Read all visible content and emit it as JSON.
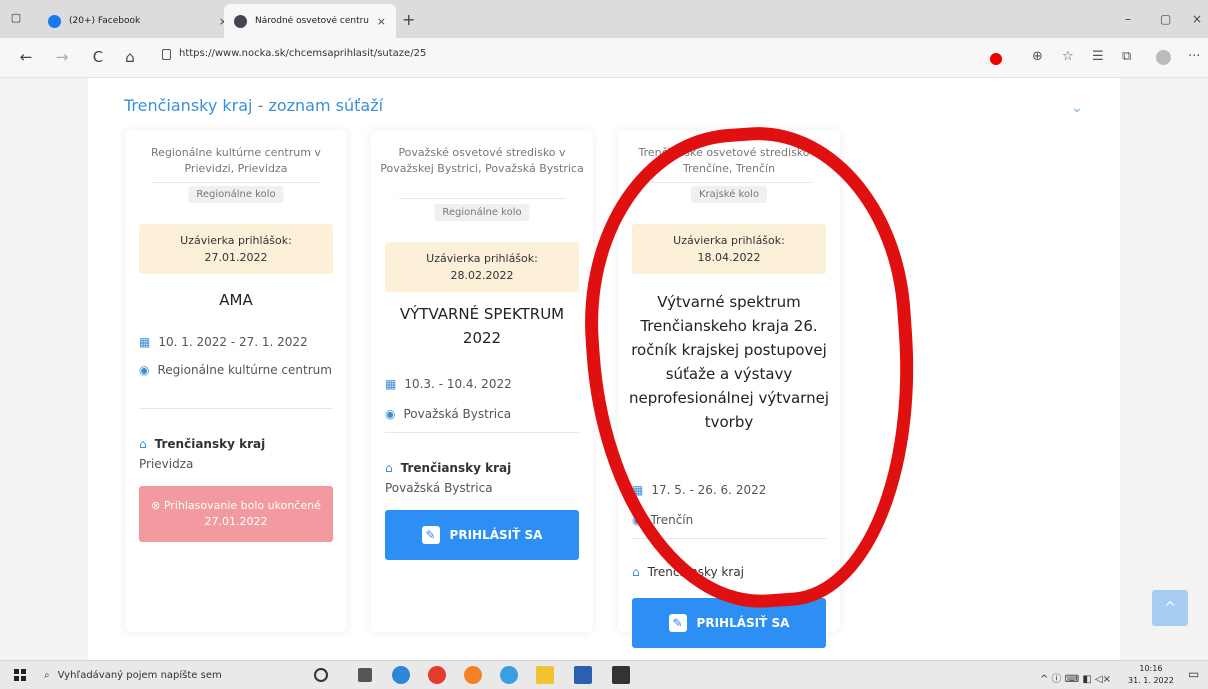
{
  "browser": {
    "tabs": [
      {
        "title": "(20+) Facebook",
        "close": "×"
      },
      {
        "title": "Národné osvetové centrum - pri",
        "close": "×"
      }
    ],
    "new_tab": "+",
    "url": "https://www.nocka.sk/chcemsaprihlasit/sutaze/25",
    "nav": {
      "back": "←",
      "forward": "→",
      "reload": "C",
      "home": "⌂"
    },
    "window_controls": {
      "minimize": "–",
      "maximize": "▢",
      "close": "×"
    },
    "more": "···",
    "accent_color": "#3a8fd8"
  },
  "page": {
    "title": "Trenčiansky kraj - zoznam súťaží",
    "collapse_icon": "⌄",
    "scroll_top_icon": "^"
  },
  "cards": [
    {
      "org": "Regionálne kultúrne centrum v Prievidzi, Prievidza",
      "round": "Regionálne kolo",
      "deadline_label": "Uzávierka prihlášok:",
      "deadline_date": "27.01.2022",
      "title": "AMA",
      "date_range": "10. 1. 2022 - 27. 1. 2022",
      "place": "Regionálne kultúrne centrum",
      "region": "Trenčiansky kraj",
      "city": "Prievidza",
      "status": {
        "icon": "⊗",
        "text": "Prihlasovanie bolo ukončené",
        "date": "27.01.2022"
      }
    },
    {
      "org": "Považské osvetové stredisko v Považskej Bystrici, Považská Bystrica",
      "round": "Regionálne kolo",
      "deadline_label": "Uzávierka prihlášok:",
      "deadline_date": "28.02.2022",
      "title": "VÝTVARNÉ SPEKTRUM 2022",
      "date_range": "10.3. - 10.4. 2022",
      "place": "Považská Bystrica",
      "region": "Trenčiansky kraj",
      "city": "Považská Bystrica",
      "button": "PRIHLÁSIŤ SA"
    },
    {
      "org": "Trenčianske osvetové stredisko v Trenčíne, Trenčín",
      "round": "Krajské kolo",
      "deadline_label": "Uzávierka prihlášok:",
      "deadline_date": "18.04.2022",
      "title": "Výtvarné spektrum Trenčianskeho kraja 26. ročník krajskej postupovej súťaže a výstavy neprofesionálnej výtvarnej tvorby",
      "date_range": "17. 5. - 26. 6. 2022",
      "place": "Trenčín",
      "region": "Trenčiansky kraj",
      "button": "PRIHLÁSIŤ SA"
    }
  ],
  "taskbar": {
    "search_placeholder": "Vyhľadávaný pojem napíšte sem",
    "time": "10:16",
    "date": "31. 1. 2022",
    "tray": "^ ⓘ ⌨ ◧ ◁×"
  }
}
